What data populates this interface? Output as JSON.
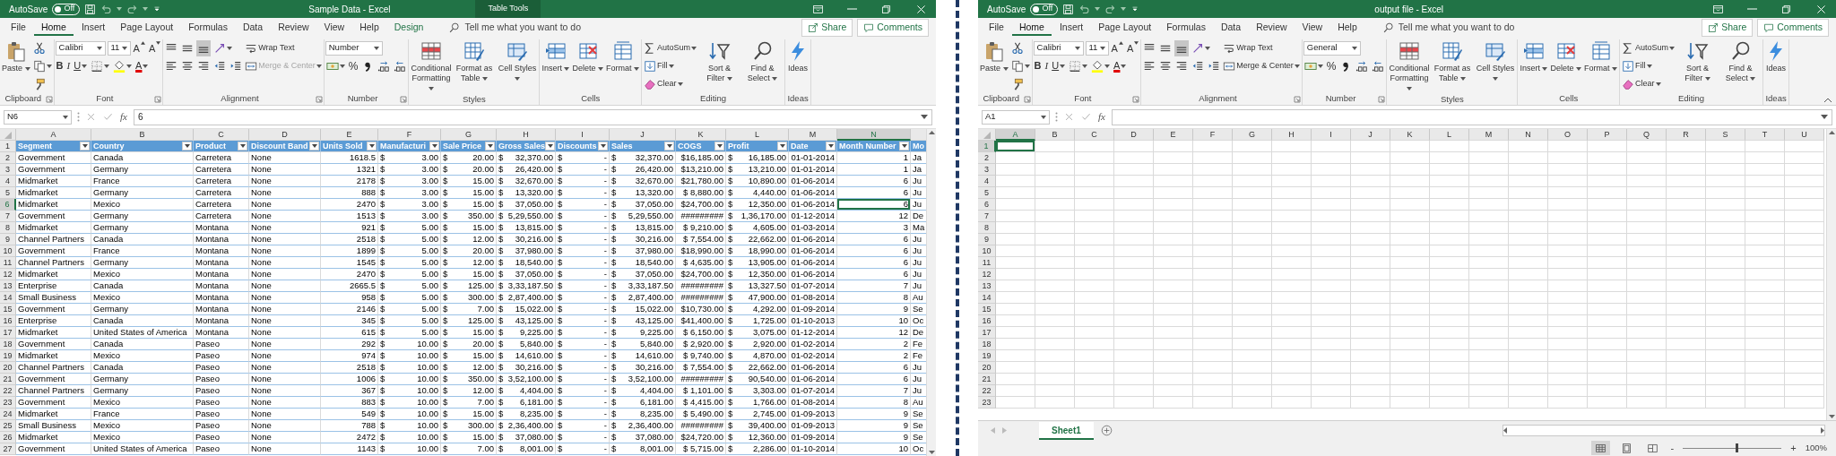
{
  "windows": [
    {
      "autosave": {
        "label": "AutoSave",
        "state": "Off",
        "on": false
      },
      "title": "Sample Data  -  Excel",
      "context_label": "Table Tools",
      "tabs": [
        {
          "label": "File",
          "selected": false,
          "contextual": false
        },
        {
          "label": "Home",
          "selected": true,
          "contextual": false
        },
        {
          "label": "Insert",
          "selected": false,
          "contextual": false
        },
        {
          "label": "Page Layout",
          "selected": false,
          "contextual": false
        },
        {
          "label": "Formulas",
          "selected": false,
          "contextual": false
        },
        {
          "label": "Data",
          "selected": false,
          "contextual": false
        },
        {
          "label": "Review",
          "selected": false,
          "contextual": false
        },
        {
          "label": "View",
          "selected": false,
          "contextual": false
        },
        {
          "label": "Help",
          "selected": false,
          "contextual": false
        },
        {
          "label": "Design",
          "selected": false,
          "contextual": true
        }
      ],
      "tell_me": "Tell me what you want to do",
      "share": "Share",
      "comments": "Comments",
      "ribbon": {
        "groups": [
          {
            "label": "Clipboard",
            "launcher": true,
            "items": [
              {
                "kind": "paste",
                "label": "Paste",
                "dropdown": true
              },
              {
                "lines": [
                  [
                    {
                      "kind": "cut"
                    }
                  ],
                  [
                    {
                      "kind": "copy",
                      "dropdown": true
                    }
                  ],
                  [
                    {
                      "kind": "format-painter"
                    }
                  ]
                ]
              }
            ]
          },
          {
            "label": "Font",
            "launcher": true,
            "items": [
              {
                "lines": [
                  [
                    {
                      "kind": "font-name",
                      "value": "Calibri"
                    },
                    {
                      "kind": "font-size",
                      "value": "11"
                    },
                    {
                      "kind": "grow-font",
                      "label": "A"
                    },
                    {
                      "kind": "shrink-font",
                      "label": "A"
                    }
                  ],
                  [
                    {
                      "kind": "bold",
                      "label": "B"
                    },
                    {
                      "kind": "italic",
                      "label": "I"
                    },
                    {
                      "kind": "underline",
                      "label": "U",
                      "dropdown": true
                    },
                    {
                      "kind": "borders",
                      "dropdown": true
                    },
                    {
                      "kind": "fill-color",
                      "dropdown": true
                    },
                    {
                      "kind": "font-color",
                      "label": "A",
                      "dropdown": true
                    }
                  ]
                ]
              }
            ]
          },
          {
            "label": "Alignment",
            "launcher": true,
            "items": [
              {
                "lines": [
                  [
                    {
                      "kind": "align-top",
                      "selected": false
                    },
                    {
                      "kind": "align-middle",
                      "selected": false
                    },
                    {
                      "kind": "align-bottom",
                      "selected": true
                    },
                    {
                      "kind": "orientation",
                      "dropdown": true
                    }
                  ],
                  [
                    {
                      "kind": "align-left",
                      "selected": false
                    },
                    {
                      "kind": "align-center",
                      "selected": false
                    },
                    {
                      "kind": "align-right",
                      "selected": false
                    },
                    {
                      "kind": "decrease-indent"
                    },
                    {
                      "kind": "increase-indent"
                    }
                  ]
                ]
              },
              {
                "lines": [
                  [
                    {
                      "kind": "wrap-text",
                      "label": "Wrap Text"
                    }
                  ],
                  [
                    {
                      "kind": "merge-center",
                      "label": "Merge & Center",
                      "dropdown": true,
                      "disabled": true
                    }
                  ]
                ]
              }
            ]
          },
          {
            "label": "Number",
            "launcher": true,
            "items": [
              {
                "lines": [
                  [
                    {
                      "kind": "number-format",
                      "value": "Number"
                    }
                  ],
                  [
                    {
                      "kind": "accounting",
                      "dropdown": true
                    },
                    {
                      "kind": "percent",
                      "label": "%"
                    },
                    {
                      "kind": "comma"
                    },
                    {
                      "kind": "increase-decimal"
                    },
                    {
                      "kind": "decrease-decimal"
                    }
                  ]
                ]
              }
            ]
          },
          {
            "label": "Styles",
            "launcher": false,
            "items": [
              {
                "kind": "conditional-formatting",
                "label": "Conditional Formatting",
                "dropdown": true
              },
              {
                "kind": "format-as-table",
                "label": "Format as Table",
                "dropdown": true
              },
              {
                "kind": "cell-styles",
                "label": "Cell Styles",
                "dropdown": true
              }
            ]
          },
          {
            "label": "Cells",
            "launcher": false,
            "items": [
              {
                "kind": "insert",
                "label": "Insert",
                "dropdown": true
              },
              {
                "kind": "delete",
                "label": "Delete",
                "dropdown": true
              },
              {
                "kind": "format",
                "label": "Format",
                "dropdown": true
              }
            ]
          },
          {
            "label": "Editing",
            "launcher": false,
            "items": [
              {
                "lines": [
                  [
                    {
                      "kind": "autosum",
                      "label": "AutoSum",
                      "dropdown": true
                    }
                  ],
                  [
                    {
                      "kind": "fill",
                      "label": "Fill",
                      "dropdown": true
                    }
                  ],
                  [
                    {
                      "kind": "clear",
                      "label": "Clear",
                      "dropdown": true
                    }
                  ]
                ]
              },
              {
                "kind": "sort-filter",
                "label": "Sort & Filter",
                "dropdown": true
              },
              {
                "kind": "find-select",
                "label": "Find & Select",
                "dropdown": true
              }
            ]
          },
          {
            "label": "Ideas",
            "launcher": false,
            "items": [
              {
                "kind": "ideas",
                "label": "Ideas"
              }
            ]
          }
        ]
      },
      "formula_bar": {
        "name_box": "N6",
        "function_label": "fx",
        "value": "6"
      },
      "sheet": {
        "columns": [
          {
            "letter": "A",
            "header": "Segment",
            "kind": "text",
            "filter": true,
            "selected": false
          },
          {
            "letter": "B",
            "header": "Country",
            "kind": "text",
            "filter": true,
            "selected": false
          },
          {
            "letter": "C",
            "header": "Product",
            "kind": "text",
            "filter": true,
            "selected": false
          },
          {
            "letter": "D",
            "header": "Discount Band",
            "kind": "text",
            "filter": true,
            "selected": false
          },
          {
            "letter": "E",
            "header": "Units Sold",
            "kind": "number",
            "filter": true,
            "selected": false
          },
          {
            "letter": "F",
            "header": "Manufacturi",
            "kind": "currency",
            "filter": true,
            "selected": false
          },
          {
            "letter": "G",
            "header": "Sale Price",
            "kind": "currency",
            "filter": true,
            "selected": false
          },
          {
            "letter": "H",
            "header": "Gross Sales",
            "kind": "currency",
            "filter": true,
            "selected": false
          },
          {
            "letter": "I",
            "header": "Discounts",
            "kind": "currency",
            "filter": true,
            "selected": false
          },
          {
            "letter": "J",
            "header": "Sales",
            "kind": "currency",
            "filter": true,
            "selected": false
          },
          {
            "letter": "K",
            "header": "COGS",
            "kind": "currency-tight",
            "filter": true,
            "selected": false
          },
          {
            "letter": "L",
            "header": "Profit",
            "kind": "currency",
            "filter": true,
            "selected": false
          },
          {
            "letter": "M",
            "header": "Date",
            "kind": "number",
            "filter": true,
            "selected": false
          },
          {
            "letter": "N",
            "header": "Month Number",
            "kind": "number",
            "filter": true,
            "selected": true
          },
          {
            "header": "Mo",
            "kind": "text",
            "filter": false
          }
        ],
        "rows": [
          {
            "number": "1",
            "kind": "header",
            "selected": false
          },
          {
            "number": "2",
            "kind": "data",
            "selected": false,
            "cells": [
              "Government",
              "Canada",
              "Carretera",
              "None",
              "1618.5",
              "$ 3.00",
              "$ 20.00",
              "$ 32,370.00",
              "$ -",
              "$ 32,370.00",
              "$16,185.00",
              "$ 16,185.00",
              "01-01-2014",
              "1",
              "Ja"
            ]
          },
          {
            "number": "3",
            "kind": "data",
            "selected": false,
            "cells": [
              "Government",
              "Germany",
              "Carretera",
              "None",
              "1321",
              "$ 3.00",
              "$ 20.00",
              "$ 26,420.00",
              "$ -",
              "$ 26,420.00",
              "$13,210.00",
              "$ 13,210.00",
              "01-01-2014",
              "1",
              "Ja"
            ]
          },
          {
            "number": "4",
            "kind": "data",
            "selected": false,
            "cells": [
              "Midmarket",
              "France",
              "Carretera",
              "None",
              "2178",
              "$ 3.00",
              "$ 15.00",
              "$ 32,670.00",
              "$ -",
              "$ 32,670.00",
              "$21,780.00",
              "$ 10,890.00",
              "01-06-2014",
              "6",
              "Ju"
            ]
          },
          {
            "number": "5",
            "kind": "data",
            "selected": false,
            "cells": [
              "Midmarket",
              "Germany",
              "Carretera",
              "None",
              "888",
              "$ 3.00",
              "$ 15.00",
              "$ 13,320.00",
              "$ -",
              "$ 13,320.00",
              "$ 8,880.00",
              "$ 4,440.00",
              "01-06-2014",
              "6",
              "Ju"
            ]
          },
          {
            "number": "6",
            "kind": "data",
            "selected": true,
            "cells": [
              "Midmarket",
              "Mexico",
              "Carretera",
              "None",
              "2470",
              "$ 3.00",
              "$ 15.00",
              "$ 37,050.00",
              "$ -",
              "$ 37,050.00",
              "$24,700.00",
              "$ 12,350.00",
              "01-06-2014",
              "6",
              "Ju"
            ]
          },
          {
            "number": "7",
            "kind": "data",
            "selected": false,
            "cells": [
              "Government",
              "Germany",
              "Carretera",
              "None",
              "1513",
              "$ 3.00",
              "$ 350.00",
              "$ 5,29,550.00",
              "$ -",
              "$ 5,29,550.00",
              "#########",
              "$ 1,36,170.00",
              "01-12-2014",
              "12",
              "De"
            ]
          },
          {
            "number": "8",
            "kind": "data",
            "selected": false,
            "cells": [
              "Midmarket",
              "Germany",
              "Montana",
              "None",
              "921",
              "$ 5.00",
              "$ 15.00",
              "$ 13,815.00",
              "$ -",
              "$ 13,815.00",
              "$ 9,210.00",
              "$ 4,605.00",
              "01-03-2014",
              "3",
              "Ma"
            ]
          },
          {
            "number": "9",
            "kind": "data",
            "selected": false,
            "cells": [
              "Channel Partners",
              "Canada",
              "Montana",
              "None",
              "2518",
              "$ 5.00",
              "$ 12.00",
              "$ 30,216.00",
              "$ -",
              "$ 30,216.00",
              "$ 7,554.00",
              "$ 22,662.00",
              "01-06-2014",
              "6",
              "Ju"
            ]
          },
          {
            "number": "10",
            "kind": "data",
            "selected": false,
            "cells": [
              "Government",
              "France",
              "Montana",
              "None",
              "1899",
              "$ 5.00",
              "$ 20.00",
              "$ 37,980.00",
              "$ -",
              "$ 37,980.00",
              "$18,990.00",
              "$ 18,990.00",
              "01-06-2014",
              "6",
              "Ju"
            ]
          },
          {
            "number": "11",
            "kind": "data",
            "selected": false,
            "cells": [
              "Channel Partners",
              "Germany",
              "Montana",
              "None",
              "1545",
              "$ 5.00",
              "$ 12.00",
              "$ 18,540.00",
              "$ -",
              "$ 18,540.00",
              "$ 4,635.00",
              "$ 13,905.00",
              "01-06-2014",
              "6",
              "Ju"
            ]
          },
          {
            "number": "12",
            "kind": "data",
            "selected": false,
            "cells": [
              "Midmarket",
              "Mexico",
              "Montana",
              "None",
              "2470",
              "$ 5.00",
              "$ 15.00",
              "$ 37,050.00",
              "$ -",
              "$ 37,050.00",
              "$24,700.00",
              "$ 12,350.00",
              "01-06-2014",
              "6",
              "Ju"
            ]
          },
          {
            "number": "13",
            "kind": "data",
            "selected": false,
            "cells": [
              "Enterprise",
              "Canada",
              "Montana",
              "None",
              "2665.5",
              "$ 5.00",
              "$ 125.00",
              "$ 3,33,187.50",
              "$ -",
              "$ 3,33,187.50",
              "#########",
              "$ 13,327.50",
              "01-07-2014",
              "7",
              "Ju"
            ]
          },
          {
            "number": "14",
            "kind": "data",
            "selected": false,
            "cells": [
              "Small Business",
              "Mexico",
              "Montana",
              "None",
              "958",
              "$ 5.00",
              "$ 300.00",
              "$ 2,87,400.00",
              "$ -",
              "$ 2,87,400.00",
              "#########",
              "$ 47,900.00",
              "01-08-2014",
              "8",
              "Au"
            ]
          },
          {
            "number": "15",
            "kind": "data",
            "selected": false,
            "cells": [
              "Government",
              "Germany",
              "Montana",
              "None",
              "2146",
              "$ 5.00",
              "$ 7.00",
              "$ 15,022.00",
              "$ -",
              "$ 15,022.00",
              "$10,730.00",
              "$ 4,292.00",
              "01-09-2014",
              "9",
              "Se"
            ]
          },
          {
            "number": "16",
            "kind": "data",
            "selected": false,
            "cells": [
              "Enterprise",
              "Canada",
              "Montana",
              "None",
              "345",
              "$ 5.00",
              "$ 125.00",
              "$ 43,125.00",
              "$ -",
              "$ 43,125.00",
              "$41,400.00",
              "$ 1,725.00",
              "01-10-2013",
              "10",
              "Oc"
            ]
          },
          {
            "number": "17",
            "kind": "data",
            "selected": false,
            "cells": [
              "Midmarket",
              "United States of America",
              "Montana",
              "None",
              "615",
              "$ 5.00",
              "$ 15.00",
              "$ 9,225.00",
              "$ -",
              "$ 9,225.00",
              "$ 6,150.00",
              "$ 3,075.00",
              "01-12-2014",
              "12",
              "De"
            ]
          },
          {
            "number": "18",
            "kind": "data",
            "selected": false,
            "cells": [
              "Government",
              "Canada",
              "Paseo",
              "None",
              "292",
              "$ 10.00",
              "$ 20.00",
              "$ 5,840.00",
              "$ -",
              "$ 5,840.00",
              "$ 2,920.00",
              "$ 2,920.00",
              "01-02-2014",
              "2",
              "Fe"
            ]
          },
          {
            "number": "19",
            "kind": "data",
            "selected": false,
            "cells": [
              "Midmarket",
              "Mexico",
              "Paseo",
              "None",
              "974",
              "$ 10.00",
              "$ 15.00",
              "$ 14,610.00",
              "$ -",
              "$ 14,610.00",
              "$ 9,740.00",
              "$ 4,870.00",
              "01-02-2014",
              "2",
              "Fe"
            ]
          },
          {
            "number": "20",
            "kind": "data",
            "selected": false,
            "cells": [
              "Channel Partners",
              "Canada",
              "Paseo",
              "None",
              "2518",
              "$ 10.00",
              "$ 12.00",
              "$ 30,216.00",
              "$ -",
              "$ 30,216.00",
              "$ 7,554.00",
              "$ 22,662.00",
              "01-06-2014",
              "6",
              "Ju"
            ]
          },
          {
            "number": "21",
            "kind": "data",
            "selected": false,
            "cells": [
              "Government",
              "Germany",
              "Paseo",
              "None",
              "1006",
              "$ 10.00",
              "$ 350.00",
              "$ 3,52,100.00",
              "$ -",
              "$ 3,52,100.00",
              "#########",
              "$ 90,540.00",
              "01-06-2014",
              "6",
              "Ju"
            ]
          },
          {
            "number": "22",
            "kind": "data",
            "selected": false,
            "cells": [
              "Channel Partners",
              "Germany",
              "Paseo",
              "None",
              "367",
              "$ 10.00",
              "$ 12.00",
              "$ 4,404.00",
              "$ -",
              "$ 4,404.00",
              "$ 1,101.00",
              "$ 3,303.00",
              "01-07-2014",
              "7",
              "Ju"
            ]
          },
          {
            "number": "23",
            "kind": "data",
            "selected": false,
            "cells": [
              "Government",
              "Mexico",
              "Paseo",
              "None",
              "883",
              "$ 10.00",
              "$ 7.00",
              "$ 6,181.00",
              "$ -",
              "$ 6,181.00",
              "$ 4,415.00",
              "$ 1,766.00",
              "01-08-2014",
              "8",
              "Au"
            ]
          },
          {
            "number": "24",
            "kind": "data",
            "selected": false,
            "cells": [
              "Midmarket",
              "France",
              "Paseo",
              "None",
              "549",
              "$ 10.00",
              "$ 15.00",
              "$ 8,235.00",
              "$ -",
              "$ 8,235.00",
              "$ 5,490.00",
              "$ 2,745.00",
              "01-09-2013",
              "9",
              "Se"
            ]
          },
          {
            "number": "25",
            "kind": "data",
            "selected": false,
            "cells": [
              "Small Business",
              "Mexico",
              "Paseo",
              "None",
              "788",
              "$ 10.00",
              "$ 300.00",
              "$ 2,36,400.00",
              "$ -",
              "$ 2,36,400.00",
              "#########",
              "$ 39,400.00",
              "01-09-2013",
              "9",
              "Se"
            ]
          },
          {
            "number": "26",
            "kind": "data",
            "selected": false,
            "cells": [
              "Midmarket",
              "Mexico",
              "Paseo",
              "None",
              "2472",
              "$ 10.00",
              "$ 15.00",
              "$ 37,080.00",
              "$ -",
              "$ 37,080.00",
              "$24,720.00",
              "$ 12,360.00",
              "01-09-2014",
              "9",
              "Se"
            ]
          },
          {
            "number": "27",
            "kind": "data",
            "selected": false,
            "cells": [
              "Government",
              "United States of America",
              "Paseo",
              "None",
              "1143",
              "$ 10.00",
              "$ 7.00",
              "$ 8,001.00",
              "$ -",
              "$ 8,001.00",
              "$ 5,715.00",
              "$ 2,286.00",
              "01-10-2014",
              "10",
              "Oc"
            ]
          }
        ]
      }
    },
    {
      "autosave": {
        "label": "AutoSave",
        "state": "Off",
        "on": false
      },
      "title": "output file  -  Excel",
      "tabs": [
        {
          "label": "File",
          "selected": false,
          "contextual": false
        },
        {
          "label": "Home",
          "selected": true,
          "contextual": false
        },
        {
          "label": "Insert",
          "selected": false,
          "contextual": false
        },
        {
          "label": "Page Layout",
          "selected": false,
          "contextual": false
        },
        {
          "label": "Formulas",
          "selected": false,
          "contextual": false
        },
        {
          "label": "Data",
          "selected": false,
          "contextual": false
        },
        {
          "label": "Review",
          "selected": false,
          "contextual": false
        },
        {
          "label": "View",
          "selected": false,
          "contextual": false
        },
        {
          "label": "Help",
          "selected": false,
          "contextual": false
        }
      ],
      "tell_me": "Tell me what you want to do",
      "share": "Share",
      "comments": "Comments",
      "ribbon": {
        "collapse_button": true,
        "groups": [
          {
            "label": "Clipboard",
            "launcher": true,
            "items": [
              {
                "kind": "paste",
                "label": "Paste",
                "dropdown": true
              },
              {
                "lines": [
                  [
                    {
                      "kind": "cut"
                    }
                  ],
                  [
                    {
                      "kind": "copy",
                      "dropdown": true
                    }
                  ],
                  [
                    {
                      "kind": "format-painter"
                    }
                  ]
                ]
              }
            ]
          },
          {
            "label": "Font",
            "launcher": true,
            "items": [
              {
                "lines": [
                  [
                    {
                      "kind": "font-name",
                      "value": "Calibri"
                    },
                    {
                      "kind": "font-size",
                      "value": "11"
                    },
                    {
                      "kind": "grow-font",
                      "label": "A"
                    },
                    {
                      "kind": "shrink-font",
                      "label": "A"
                    }
                  ],
                  [
                    {
                      "kind": "bold",
                      "label": "B"
                    },
                    {
                      "kind": "italic",
                      "label": "I"
                    },
                    {
                      "kind": "underline",
                      "label": "U",
                      "dropdown": true
                    },
                    {
                      "kind": "borders",
                      "dropdown": true
                    },
                    {
                      "kind": "fill-color",
                      "dropdown": true
                    },
                    {
                      "kind": "font-color",
                      "label": "A",
                      "dropdown": true
                    }
                  ]
                ]
              }
            ]
          },
          {
            "label": "Alignment",
            "launcher": true,
            "items": [
              {
                "lines": [
                  [
                    {
                      "kind": "align-top",
                      "selected": false
                    },
                    {
                      "kind": "align-middle",
                      "selected": false
                    },
                    {
                      "kind": "align-bottom",
                      "selected": true
                    },
                    {
                      "kind": "orientation",
                      "dropdown": true
                    }
                  ],
                  [
                    {
                      "kind": "align-left",
                      "selected": false
                    },
                    {
                      "kind": "align-center",
                      "selected": false
                    },
                    {
                      "kind": "align-right",
                      "selected": false
                    },
                    {
                      "kind": "decrease-indent"
                    },
                    {
                      "kind": "increase-indent"
                    }
                  ]
                ]
              },
              {
                "lines": [
                  [
                    {
                      "kind": "wrap-text",
                      "label": "Wrap Text"
                    }
                  ],
                  [
                    {
                      "kind": "merge-center",
                      "label": "Merge & Center",
                      "dropdown": true,
                      "disabled": false
                    }
                  ]
                ]
              }
            ]
          },
          {
            "label": "Number",
            "launcher": true,
            "items": [
              {
                "lines": [
                  [
                    {
                      "kind": "number-format",
                      "value": "General"
                    }
                  ],
                  [
                    {
                      "kind": "accounting",
                      "dropdown": true
                    },
                    {
                      "kind": "percent",
                      "label": "%"
                    },
                    {
                      "kind": "comma"
                    },
                    {
                      "kind": "increase-decimal"
                    },
                    {
                      "kind": "decrease-decimal"
                    }
                  ]
                ]
              }
            ]
          },
          {
            "label": "Styles",
            "launcher": false,
            "items": [
              {
                "kind": "conditional-formatting",
                "label": "Conditional Formatting",
                "dropdown": true
              },
              {
                "kind": "format-as-table",
                "label": "Format as Table",
                "dropdown": true
              },
              {
                "kind": "cell-styles",
                "label": "Cell Styles",
                "dropdown": true
              }
            ]
          },
          {
            "label": "Cells",
            "launcher": false,
            "items": [
              {
                "kind": "insert",
                "label": "Insert",
                "dropdown": true
              },
              {
                "kind": "delete",
                "label": "Delete",
                "dropdown": true
              },
              {
                "kind": "format",
                "label": "Format",
                "dropdown": true
              }
            ]
          },
          {
            "label": "Editing",
            "launcher": false,
            "items": [
              {
                "lines": [
                  [
                    {
                      "kind": "autosum",
                      "label": "AutoSum",
                      "dropdown": true
                    }
                  ],
                  [
                    {
                      "kind": "fill",
                      "label": "Fill",
                      "dropdown": true
                    }
                  ],
                  [
                    {
                      "kind": "clear",
                      "label": "Clear",
                      "dropdown": true
                    }
                  ]
                ]
              },
              {
                "kind": "sort-filter",
                "label": "Sort & Filter",
                "dropdown": true
              },
              {
                "kind": "find-select",
                "label": "Find & Select",
                "dropdown": true
              }
            ]
          },
          {
            "label": "Ideas",
            "launcher": false,
            "items": [
              {
                "kind": "ideas",
                "label": "Ideas"
              }
            ]
          }
        ]
      },
      "formula_bar": {
        "name_box": "A1",
        "function_label": "fx"
      },
      "sheet": {
        "columns": [
          {
            "letter": "A",
            "selected": true
          },
          {
            "letter": "B",
            "selected": false
          },
          {
            "letter": "C",
            "selected": false
          },
          {
            "letter": "D",
            "selected": false
          },
          {
            "letter": "E",
            "selected": false
          },
          {
            "letter": "F",
            "selected": false
          },
          {
            "letter": "G",
            "selected": false
          },
          {
            "letter": "H",
            "selected": false
          },
          {
            "letter": "I",
            "selected": false
          },
          {
            "letter": "J",
            "selected": false
          },
          {
            "letter": "K",
            "selected": false
          },
          {
            "letter": "L",
            "selected": false
          },
          {
            "letter": "M",
            "selected": false
          },
          {
            "letter": "N",
            "selected": false
          },
          {
            "letter": "O",
            "selected": false
          },
          {
            "letter": "P",
            "selected": false
          },
          {
            "letter": "Q",
            "selected": false
          },
          {
            "letter": "R",
            "selected": false
          },
          {
            "letter": "S",
            "selected": false
          },
          {
            "letter": "T",
            "selected": false
          },
          {
            "letter": "U",
            "selected": false
          }
        ],
        "rows": [
          {
            "number": "1",
            "kind": "empty",
            "selected": true
          },
          {
            "number": "2",
            "kind": "empty",
            "selected": false
          },
          {
            "number": "3",
            "kind": "empty",
            "selected": false
          },
          {
            "number": "4",
            "kind": "empty",
            "selected": false
          },
          {
            "number": "5",
            "kind": "empty",
            "selected": false
          },
          {
            "number": "6",
            "kind": "empty",
            "selected": false
          },
          {
            "number": "7",
            "kind": "empty",
            "selected": false
          },
          {
            "number": "8",
            "kind": "empty",
            "selected": false
          },
          {
            "number": "9",
            "kind": "empty",
            "selected": false
          },
          {
            "number": "10",
            "kind": "empty",
            "selected": false
          },
          {
            "number": "11",
            "kind": "empty",
            "selected": false
          },
          {
            "number": "12",
            "kind": "empty",
            "selected": false
          },
          {
            "number": "13",
            "kind": "empty",
            "selected": false
          },
          {
            "number": "14",
            "kind": "empty",
            "selected": false
          },
          {
            "number": "15",
            "kind": "empty",
            "selected": false
          },
          {
            "number": "16",
            "kind": "empty",
            "selected": false
          },
          {
            "number": "17",
            "kind": "empty",
            "selected": false
          },
          {
            "number": "18",
            "kind": "empty",
            "selected": false
          },
          {
            "number": "19",
            "kind": "empty",
            "selected": false
          },
          {
            "number": "20",
            "kind": "empty",
            "selected": false
          },
          {
            "number": "21",
            "kind": "empty",
            "selected": false
          },
          {
            "number": "22",
            "kind": "empty",
            "selected": false
          },
          {
            "number": "23",
            "kind": "empty",
            "selected": false
          }
        ]
      },
      "sheet_tabs": [
        {
          "label": "Sheet1",
          "selected": true
        }
      ],
      "status_bar": {
        "views": [
          {
            "kind": "normal",
            "selected": true
          },
          {
            "kind": "page-layout",
            "selected": false
          },
          {
            "kind": "page-break",
            "selected": false
          }
        ],
        "zoom": {
          "minus": "-",
          "plus": "+",
          "level": 0.55,
          "reading": "100%"
        }
      }
    }
  ]
}
